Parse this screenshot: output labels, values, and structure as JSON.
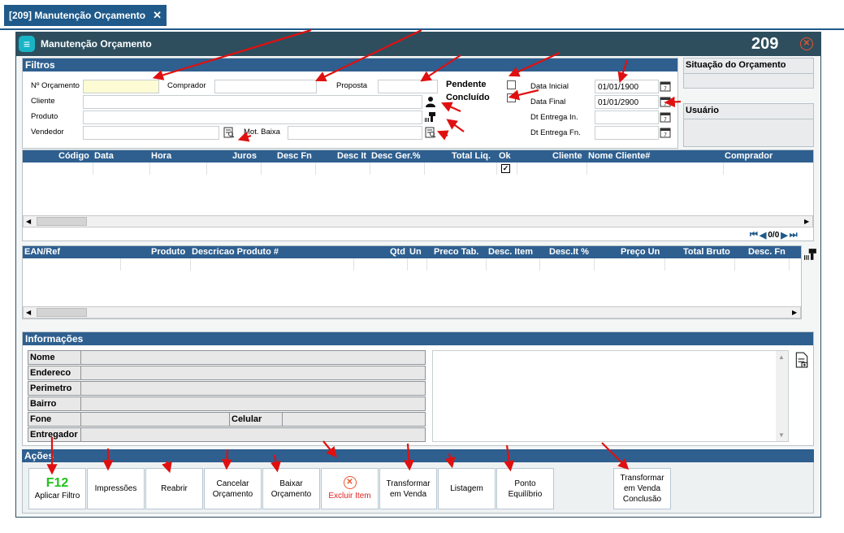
{
  "tab": {
    "label": "[209] Manutenção Orçamento",
    "close": "✕"
  },
  "window": {
    "title": "Manutenção Orçamento",
    "code": "209",
    "close": "✕"
  },
  "filtros": {
    "heading": "Filtros",
    "n_orcamento": "Nº Orçamento",
    "comprador": "Comprador",
    "proposta": "Proposta",
    "cliente": "Cliente",
    "produto": "Produto",
    "vendedor": "Vendedor",
    "mot_baixa": "Mot. Baixa",
    "pendente": "Pendente",
    "concluido": "Concluído",
    "data_inicial": "Data Inicial",
    "data_inicial_value": "01/01/1900",
    "data_final": "Data Final",
    "data_final_value": "01/01/2900",
    "dt_entrega_in": "Dt Entrega In.",
    "dt_entrega_fn": "Dt Entrega Fn."
  },
  "situacao": {
    "title": "Situação do Orçamento"
  },
  "usuario": {
    "title": "Usuário"
  },
  "grid1": {
    "columns": [
      "Código",
      "Data",
      "Hora",
      "Juros",
      "Desc Fn",
      "Desc It",
      "Desc Ger.%",
      "Total Liq.",
      "Ok",
      "Cliente",
      "Nome Cliente#",
      "Comprador"
    ]
  },
  "nav": {
    "counter": "0/0"
  },
  "grid2": {
    "columns": [
      "EAN/Ref",
      "Produto",
      "Descricao Produto #",
      "Qtd",
      "Un",
      "Preco Tab.",
      "Desc. Item",
      "Desc.It %",
      "Preço Un",
      "Total Bruto",
      "Desc. Fn"
    ]
  },
  "informacoes": {
    "heading": "Informações",
    "nome": "Nome",
    "endereco": "Endereco",
    "perimetro": "Perimetro",
    "bairro": "Bairro",
    "fone": "Fone",
    "celular": "Celular",
    "entregador": "Entregador"
  },
  "acoes": {
    "heading": "Ações",
    "buttons": {
      "aplicar_key": "F12",
      "aplicar": "Aplicar Filtro",
      "impressoes": "Impressões",
      "reabrir": "Reabrir",
      "cancelar1": "Cancelar",
      "cancelar2": "Orçamento",
      "baixar1": "Baixar",
      "baixar2": "Orçamento",
      "excluir": "Excluir Item",
      "transformar1": "Transformar",
      "transformar2": "em Venda",
      "listagem": "Listagem",
      "ponto1": "Ponto",
      "ponto2": "Equilíbrio",
      "transconc1": "Transformar",
      "transconc2": "em Venda",
      "transconc3": "Conclusão"
    }
  },
  "colors": {
    "accent": "#2e5f8f",
    "titlebar": "#2e4e5e",
    "arrow": "#e01010",
    "danger": "#e8552b"
  }
}
